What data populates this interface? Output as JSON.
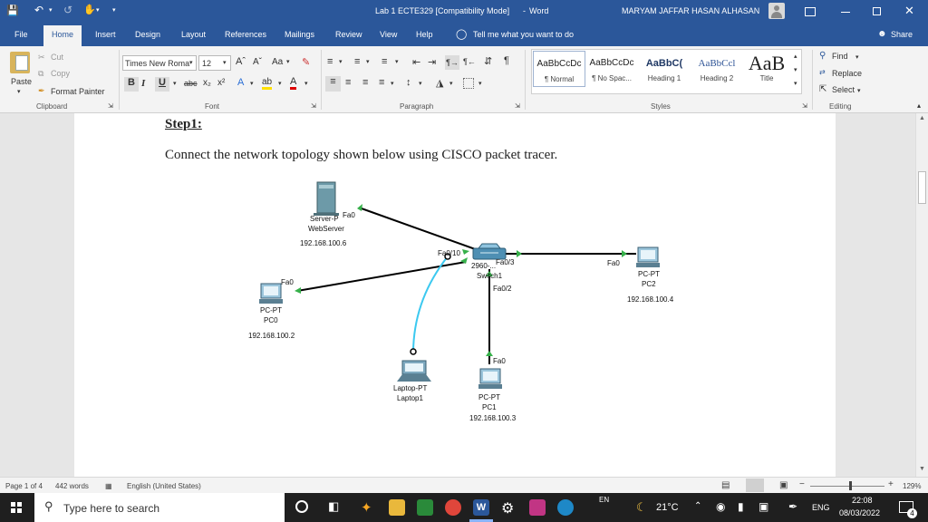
{
  "titlebar": {
    "doc_title": "Lab 1 ECTE329 [Compatibility Mode]",
    "app": "Word",
    "separator": "-",
    "user": "MARYAM JAFFAR HASAN ALHASAN"
  },
  "tabs": [
    "File",
    "Home",
    "Insert",
    "Design",
    "Layout",
    "References",
    "Mailings",
    "Review",
    "View",
    "Help"
  ],
  "tell_me": "Tell me what you want to do",
  "share": "Share",
  "clipboard": {
    "paste": "Paste",
    "cut": "Cut",
    "copy": "Copy",
    "format_painter": "Format Painter",
    "label": "Clipboard"
  },
  "font": {
    "name": "Times New Roma",
    "size": "12",
    "label": "Font",
    "case": "Aa"
  },
  "paragraph_label": "Paragraph",
  "styles": {
    "label": "Styles",
    "items": [
      {
        "preview": "AaBbCcDc",
        "name": "¶ Normal"
      },
      {
        "preview": "AaBbCcDc",
        "name": "¶ No Spac..."
      },
      {
        "preview": "AaBbC(",
        "name": "Heading 1"
      },
      {
        "preview": "AaBbCcl",
        "name": "Heading 2"
      },
      {
        "preview": "AaB",
        "name": "Title"
      }
    ]
  },
  "editing": {
    "find": "Find",
    "replace": "Replace",
    "select": "Select",
    "label": "Editing"
  },
  "document": {
    "step": "Step1:",
    "instruction": "Connect the network topology shown below using CISCO packet tracer.",
    "topology": {
      "server": {
        "type": "Server-P",
        "name": "WebServer",
        "ip": "192.168.100.6",
        "port": "Fa0"
      },
      "switch": {
        "model": "2960-...",
        "name": "Switch1",
        "ports": [
          "Fa0/10",
          "Fa0/3",
          "Fa0/2"
        ]
      },
      "pc0": {
        "type": "PC-PT",
        "name": "PC0",
        "ip": "192.168.100.2",
        "port": "Fa0"
      },
      "pc1": {
        "type": "PC-PT",
        "name": "PC1",
        "ip": "192.168.100.3",
        "port": "Fa0"
      },
      "pc2": {
        "type": "PC-PT",
        "name": "PC2",
        "ip": "192.168.100.4",
        "port": "Fa0"
      },
      "laptop": {
        "type": "Laptop-PT",
        "name": "Laptop1"
      }
    }
  },
  "status": {
    "page": "Page 1 of 4",
    "words": "442 words",
    "language": "English (United States)",
    "zoom": "129%",
    "zoom_level": 1.29
  },
  "taskbar": {
    "search": "Type here to search",
    "weather": "21°C",
    "lang": "ENG",
    "ime": "EN",
    "time": "22:08",
    "date": "08/03/2022",
    "notifications": "4"
  },
  "colors": {
    "word_blue": "#2b579a",
    "link_green": "#36b04a",
    "wireless": "#3cc9f0"
  }
}
